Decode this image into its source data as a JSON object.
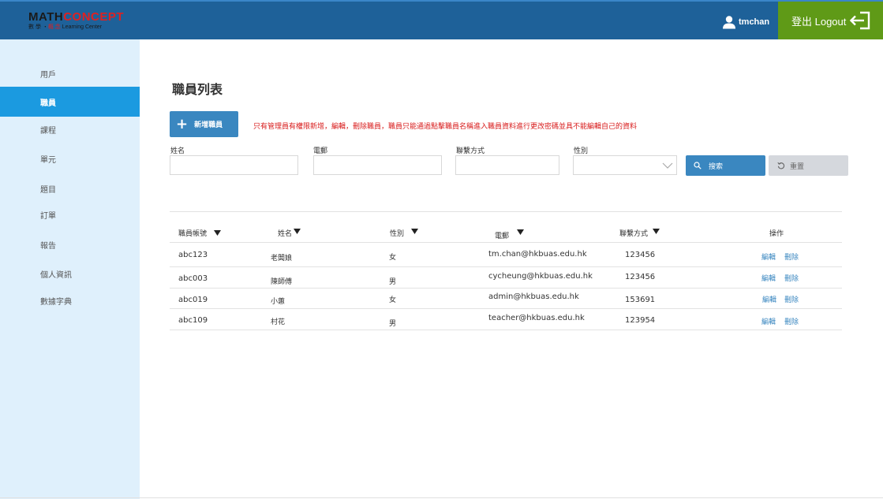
{
  "header": {
    "logo": {
      "math": "MATH",
      "concept": "CONCEPT",
      "cn_black": "數 學 ・",
      "cn_red": "概 念",
      "learning": "Learning Center"
    },
    "username": "tmchan",
    "logout_label": "登出 Logout",
    "colors": {
      "bar": "#1e6199",
      "logout": "#5f9a17"
    }
  },
  "sidebar": {
    "items": [
      {
        "label": "用戶",
        "active": false
      },
      {
        "label": "職員",
        "active": true
      },
      {
        "label": "課程",
        "active": false
      },
      {
        "label": "單元",
        "active": false
      },
      {
        "label": "題目",
        "active": false
      },
      {
        "label": "訂單",
        "active": false
      },
      {
        "label": "報告",
        "active": false
      },
      {
        "label": "個人資訊",
        "active": false
      },
      {
        "label": "數據字典",
        "active": false
      }
    ],
    "colors": {
      "background": "#dff0fc",
      "active": "#1b9ae0"
    }
  },
  "main": {
    "title": "職員列表",
    "add_button": "新增職員",
    "notice": "只有管理員有權限新增，編輯，刪除職員，職員只能通過點擊職員名稱進入職員資料進行更改密碼並具不能編輯自己的資料",
    "filters": {
      "name_label": "姓名",
      "email_label": "電郵",
      "contact_label": "聯繫方式",
      "gender_label": "性別",
      "name_value": "",
      "email_value": "",
      "contact_value": "",
      "gender_value": "",
      "search_button": "搜索",
      "reset_button": "重置"
    },
    "table": {
      "headers": {
        "account": "職員帳號",
        "name": "姓名",
        "gender": "性別",
        "email": "電郵",
        "contact": "聯繫方式",
        "actions": "操作"
      },
      "edit_label": "編輯",
      "delete_label": "刪除",
      "rows": [
        {
          "account": "abc123",
          "name": "老闆娘",
          "gender": "女",
          "email": "tm.chan@hkbuas.edu.hk",
          "contact": "123456"
        },
        {
          "account": "abc003",
          "name": "陳師傅",
          "gender": "男",
          "email": "cycheung@hkbuas.edu.hk",
          "contact": "123456"
        },
        {
          "account": "abc019",
          "name": "小蕙",
          "gender": "女",
          "email": "admin@hkbuas.edu.hk",
          "contact": "153691"
        },
        {
          "account": "abc109",
          "name": "村花",
          "gender": "男",
          "email": "teacher@hkbuas.edu.hk",
          "contact": "123954"
        }
      ]
    },
    "colors": {
      "accent": "#3a87c0",
      "notice": "#d81b1b",
      "reset": "#d5d8dd"
    }
  }
}
